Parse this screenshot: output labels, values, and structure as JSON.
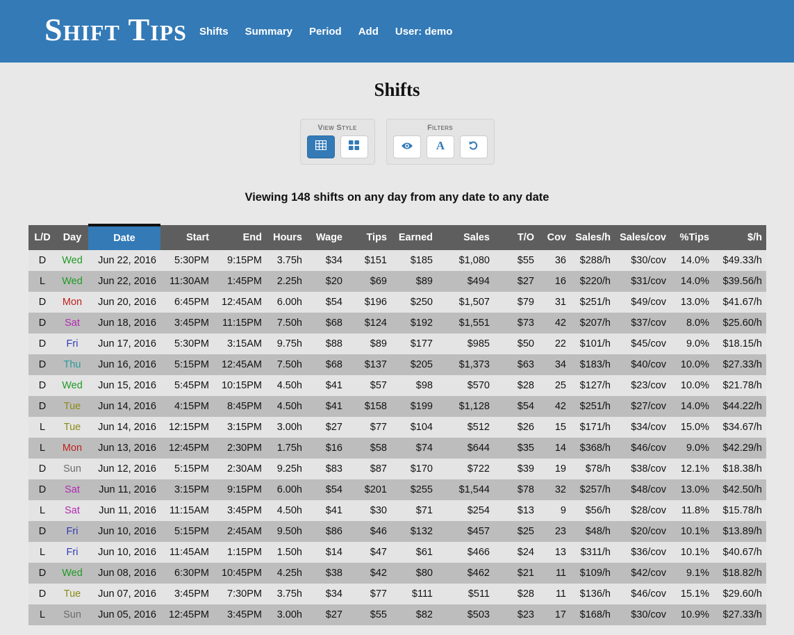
{
  "nav": {
    "brand": "Shift Tips",
    "links": [
      "Shifts",
      "Summary",
      "Period",
      "Add",
      "User: demo"
    ]
  },
  "page": {
    "title": "Shifts",
    "view_style_label": "View Style",
    "filters_label": "Filters",
    "viewing_text": "Viewing 148 shifts on any day from any date to any date"
  },
  "colors": {
    "accent": "#337ab7",
    "header_bg": "#5e5e5e",
    "lunch": "#b5641a",
    "dinner": "#2a63b0",
    "days": {
      "Mon": "#c0211f",
      "Tue": "#8a8a1a",
      "Wed": "#1f9a24",
      "Thu": "#2a9a9a",
      "Fri": "#2f3ab4",
      "Sat": "#b22ab2",
      "Sun": "#6b6b6b"
    }
  },
  "icons": {
    "table_view": "table-grid-icon",
    "card_view": "four-squares-icon",
    "visibility": "eye-icon",
    "font": "letter-a-icon",
    "reset": "undo-icon"
  },
  "table": {
    "sorted_column": "Date",
    "columns": [
      "L/D",
      "Day",
      "Date",
      "Start",
      "End",
      "Hours",
      "Wage",
      "Tips",
      "Earned",
      "Sales",
      "T/O",
      "Cov",
      "Sales/h",
      "Sales/cov",
      "%Tips",
      "$/h"
    ],
    "rows": [
      [
        "D",
        "Wed",
        "Jun 22, 2016",
        "5:30PM",
        "9:15PM",
        "3.75h",
        "$34",
        "$151",
        "$185",
        "$1,080",
        "$55",
        "36",
        "$288/h",
        "$30/cov",
        "14.0%",
        "$49.33/h"
      ],
      [
        "L",
        "Wed",
        "Jun 22, 2016",
        "11:30AM",
        "1:45PM",
        "2.25h",
        "$20",
        "$69",
        "$89",
        "$494",
        "$27",
        "16",
        "$220/h",
        "$31/cov",
        "14.0%",
        "$39.56/h"
      ],
      [
        "D",
        "Mon",
        "Jun 20, 2016",
        "6:45PM",
        "12:45AM",
        "6.00h",
        "$54",
        "$196",
        "$250",
        "$1,507",
        "$79",
        "31",
        "$251/h",
        "$49/cov",
        "13.0%",
        "$41.67/h"
      ],
      [
        "D",
        "Sat",
        "Jun 18, 2016",
        "3:45PM",
        "11:15PM",
        "7.50h",
        "$68",
        "$124",
        "$192",
        "$1,551",
        "$73",
        "42",
        "$207/h",
        "$37/cov",
        "8.0%",
        "$25.60/h"
      ],
      [
        "D",
        "Fri",
        "Jun 17, 2016",
        "5:30PM",
        "3:15AM",
        "9.75h",
        "$88",
        "$89",
        "$177",
        "$985",
        "$50",
        "22",
        "$101/h",
        "$45/cov",
        "9.0%",
        "$18.15/h"
      ],
      [
        "D",
        "Thu",
        "Jun 16, 2016",
        "5:15PM",
        "12:45AM",
        "7.50h",
        "$68",
        "$137",
        "$205",
        "$1,373",
        "$63",
        "34",
        "$183/h",
        "$40/cov",
        "10.0%",
        "$27.33/h"
      ],
      [
        "D",
        "Wed",
        "Jun 15, 2016",
        "5:45PM",
        "10:15PM",
        "4.50h",
        "$41",
        "$57",
        "$98",
        "$570",
        "$28",
        "25",
        "$127/h",
        "$23/cov",
        "10.0%",
        "$21.78/h"
      ],
      [
        "D",
        "Tue",
        "Jun 14, 2016",
        "4:15PM",
        "8:45PM",
        "4.50h",
        "$41",
        "$158",
        "$199",
        "$1,128",
        "$54",
        "42",
        "$251/h",
        "$27/cov",
        "14.0%",
        "$44.22/h"
      ],
      [
        "L",
        "Tue",
        "Jun 14, 2016",
        "12:15PM",
        "3:15PM",
        "3.00h",
        "$27",
        "$77",
        "$104",
        "$512",
        "$26",
        "15",
        "$171/h",
        "$34/cov",
        "15.0%",
        "$34.67/h"
      ],
      [
        "L",
        "Mon",
        "Jun 13, 2016",
        "12:45PM",
        "2:30PM",
        "1.75h",
        "$16",
        "$58",
        "$74",
        "$644",
        "$35",
        "14",
        "$368/h",
        "$46/cov",
        "9.0%",
        "$42.29/h"
      ],
      [
        "D",
        "Sun",
        "Jun 12, 2016",
        "5:15PM",
        "2:30AM",
        "9.25h",
        "$83",
        "$87",
        "$170",
        "$722",
        "$39",
        "19",
        "$78/h",
        "$38/cov",
        "12.1%",
        "$18.38/h"
      ],
      [
        "D",
        "Sat",
        "Jun 11, 2016",
        "3:15PM",
        "9:15PM",
        "6.00h",
        "$54",
        "$201",
        "$255",
        "$1,544",
        "$78",
        "32",
        "$257/h",
        "$48/cov",
        "13.0%",
        "$42.50/h"
      ],
      [
        "L",
        "Sat",
        "Jun 11, 2016",
        "11:15AM",
        "3:45PM",
        "4.50h",
        "$41",
        "$30",
        "$71",
        "$254",
        "$13",
        "9",
        "$56/h",
        "$28/cov",
        "11.8%",
        "$15.78/h"
      ],
      [
        "D",
        "Fri",
        "Jun 10, 2016",
        "5:15PM",
        "2:45AM",
        "9.50h",
        "$86",
        "$46",
        "$132",
        "$457",
        "$25",
        "23",
        "$48/h",
        "$20/cov",
        "10.1%",
        "$13.89/h"
      ],
      [
        "L",
        "Fri",
        "Jun 10, 2016",
        "11:45AM",
        "1:15PM",
        "1.50h",
        "$14",
        "$47",
        "$61",
        "$466",
        "$24",
        "13",
        "$311/h",
        "$36/cov",
        "10.1%",
        "$40.67/h"
      ],
      [
        "D",
        "Wed",
        "Jun 08, 2016",
        "6:30PM",
        "10:45PM",
        "4.25h",
        "$38",
        "$42",
        "$80",
        "$462",
        "$21",
        "11",
        "$109/h",
        "$42/cov",
        "9.1%",
        "$18.82/h"
      ],
      [
        "D",
        "Tue",
        "Jun 07, 2016",
        "3:45PM",
        "7:30PM",
        "3.75h",
        "$34",
        "$77",
        "$111",
        "$511",
        "$28",
        "11",
        "$136/h",
        "$46/cov",
        "15.1%",
        "$29.60/h"
      ],
      [
        "L",
        "Sun",
        "Jun 05, 2016",
        "12:45PM",
        "3:45PM",
        "3.00h",
        "$27",
        "$55",
        "$82",
        "$503",
        "$23",
        "17",
        "$168/h",
        "$30/cov",
        "10.9%",
        "$27.33/h"
      ]
    ]
  }
}
